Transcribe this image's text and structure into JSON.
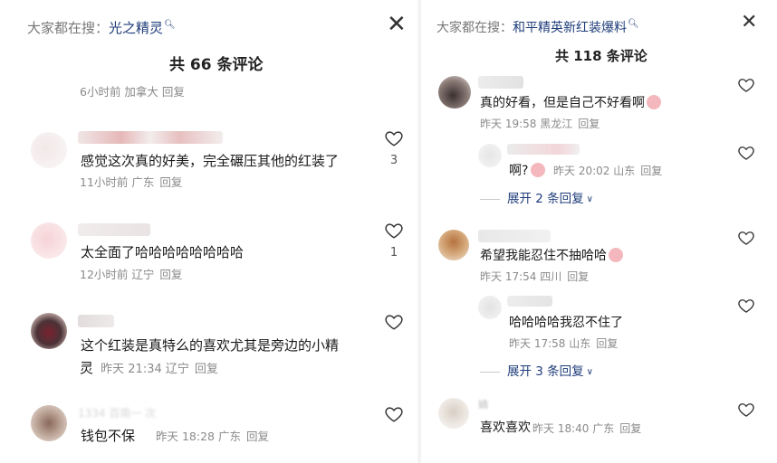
{
  "left": {
    "search_prefix": "大家都在搜：",
    "search_keyword": "光之精灵",
    "comment_count_title": "共 66 条评论",
    "top_meta": "6小时前 加拿大 回复",
    "comments": [
      {
        "text": "感觉这次真的好美，完全碾压其他的红装了",
        "time": "11小时前",
        "location": "广东",
        "reply": "回复",
        "likes": "3"
      },
      {
        "text": "太全面了哈哈哈哈哈哈哈哈",
        "time": "12小时前",
        "location": "辽宁",
        "reply": "回复",
        "likes": "1"
      },
      {
        "text": "这个红装是真特么的喜欢尤其是旁边的小精",
        "text2": "灵",
        "time": "昨天 21:34",
        "location": "辽宁",
        "reply": "回复",
        "likes": ""
      },
      {
        "name_fragment": "1334 百南一 次",
        "text": "钱包不保",
        "time": "昨天 18:28",
        "location": "广东",
        "reply": "回复",
        "likes": ""
      }
    ]
  },
  "right": {
    "search_prefix": "大家都在搜：",
    "search_keyword": "和平精英新红装爆料",
    "comment_count_title": "共 118 条评论",
    "comments": [
      {
        "text": "真的好看，但是自己不好看啊",
        "time": "昨天 19:58",
        "location": "黑龙江",
        "reply": "回复"
      },
      {
        "text": "啊?",
        "time": "昨天 20:02",
        "location": "山东",
        "reply": "回复"
      },
      {
        "expand": "展开 2 条回复"
      },
      {
        "text": "希望我能忍住不抽哈哈",
        "time": "昨天 17:54",
        "location": "四川",
        "reply": "回复"
      },
      {
        "text": "哈哈哈哈我忍不住了",
        "time": "昨天 17:58",
        "location": "山东",
        "reply": "回复"
      },
      {
        "expand": "展开 3 条回复"
      },
      {
        "name_fragment": "嫡",
        "text": "喜欢喜欢",
        "time": "昨天 18:40",
        "location": "广东",
        "reply": "回复"
      }
    ]
  },
  "icons": {
    "close": "close-icon",
    "heart": "heart-icon",
    "search_hint": "search-hint-icon",
    "emoji": "blush-emoji-icon",
    "chevron": "chevron-down-icon"
  }
}
